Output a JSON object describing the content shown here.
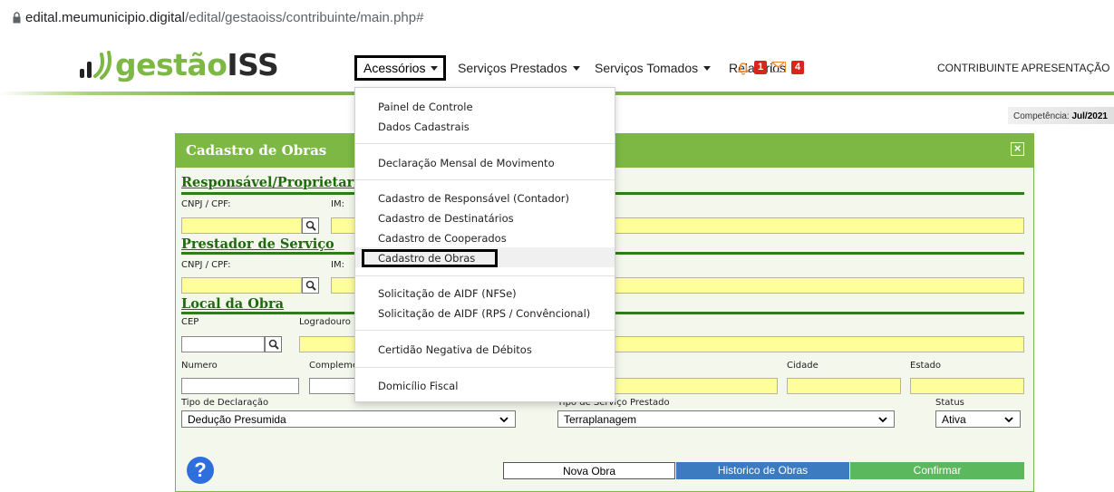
{
  "browser": {
    "url_host": "edital.meumunicipio.digital",
    "url_path": "/edital/gestaoiss/contribuinte/main.php#"
  },
  "header": {
    "logo_main": "gestão",
    "logo_suffix": "ISS",
    "nav": [
      {
        "label": "Acessórios"
      },
      {
        "label": "Serviços Prestados"
      },
      {
        "label": "Serviços Tomados"
      },
      {
        "label": "Relatórios"
      }
    ],
    "notifications_count": "1",
    "messages_count": "4",
    "user_label": "CONTRIBUINTE APRESENTAÇÃO",
    "competencia_label": "Competência:",
    "competencia_value": "Jul/2021"
  },
  "menu": {
    "items": [
      "Painel de Controle",
      "Dados Cadastrais",
      "Declaração Mensal de Movimento",
      "Cadastro de Responsável (Contador)",
      "Cadastro de Destinatários",
      "Cadastro de Cooperados",
      "Cadastro de Obras",
      "Solicitação de AIDF (NFSe)",
      "Solicitação de AIDF (RPS / Convêncional)",
      "Certidão Negativa de Débitos",
      "Domicílio Fiscal"
    ]
  },
  "panel": {
    "title": "Cadastro de Obras",
    "responsavel": {
      "title": "Responsável/Proprietario",
      "cnpj_label": "CNPJ / CPF:",
      "im_label": "IM:"
    },
    "prestador": {
      "title": "Prestador de Serviço",
      "cnpj_label": "CNPJ / CPF:",
      "im_label": "IM:"
    },
    "local": {
      "title": "Local da Obra",
      "cep_label": "CEP",
      "logradouro_label": "Logradouro",
      "numero_label": "Numero",
      "complemento_label": "Compleme",
      "cidade_label": "Cidade",
      "estado_label": "Estado"
    },
    "tipo_declaracao_label": "Tipo de Declaração",
    "tipo_declaracao_value": "Dedução Presumida",
    "tipo_servico_label": "Tipo de Serviço Prestado",
    "tipo_servico_value": "Terraplanagem",
    "status_label": "Status",
    "status_value": "Ativa"
  },
  "buttons": {
    "nova": "Nova Obra",
    "historico": "Historico de Obras",
    "confirmar": "Confirmar"
  },
  "colors": {
    "brand_green": "#7cb843",
    "section_green": "#1f6a0e",
    "field_yellow": "#ffff99",
    "historico_blue": "#3c7bbf",
    "confirmar_green": "#5cb85c"
  }
}
